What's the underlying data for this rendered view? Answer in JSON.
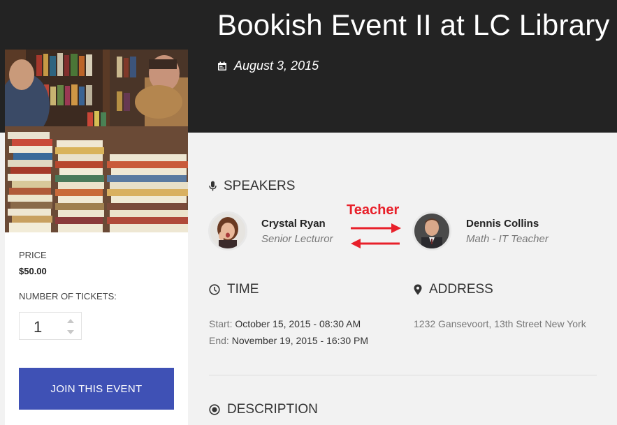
{
  "event": {
    "title": "Bookish Event II at LC Library",
    "date": "August 3, 2015"
  },
  "ticket": {
    "price_label": "PRICE",
    "price_value": "$50.00",
    "tickets_label": "NUMBER OF TICKETS:",
    "tickets_value": "1",
    "join_label": "JOIN THIS EVENT"
  },
  "speakers": {
    "heading": "SPEAKERS",
    "list": [
      {
        "name": "Crystal Ryan",
        "role": "Senior Lecturor"
      },
      {
        "name": "Dennis Collins",
        "role": "Math - IT Teacher"
      }
    ],
    "annotation": "Teacher"
  },
  "time": {
    "heading": "TIME",
    "start_label": "Start:",
    "start_value": "October 15, 2015 - 08:30 AM",
    "end_label": "End:",
    "end_value": "November 19, 2015 - 16:30 PM"
  },
  "address": {
    "heading": "ADDRESS",
    "text": "1232 Gansevoort, 13th Street New York"
  },
  "description": {
    "heading": "DESCRIPTION"
  },
  "colors": {
    "header_bg": "#232323",
    "accent": "#3f51b5",
    "annotation": "#e8202a",
    "page_bg": "#f2f2f2"
  },
  "icons": {
    "date": "calendar-icon",
    "speakers": "microphone-icon",
    "time": "clock-icon",
    "address": "map-pin-icon",
    "description": "radio-dot-icon"
  }
}
